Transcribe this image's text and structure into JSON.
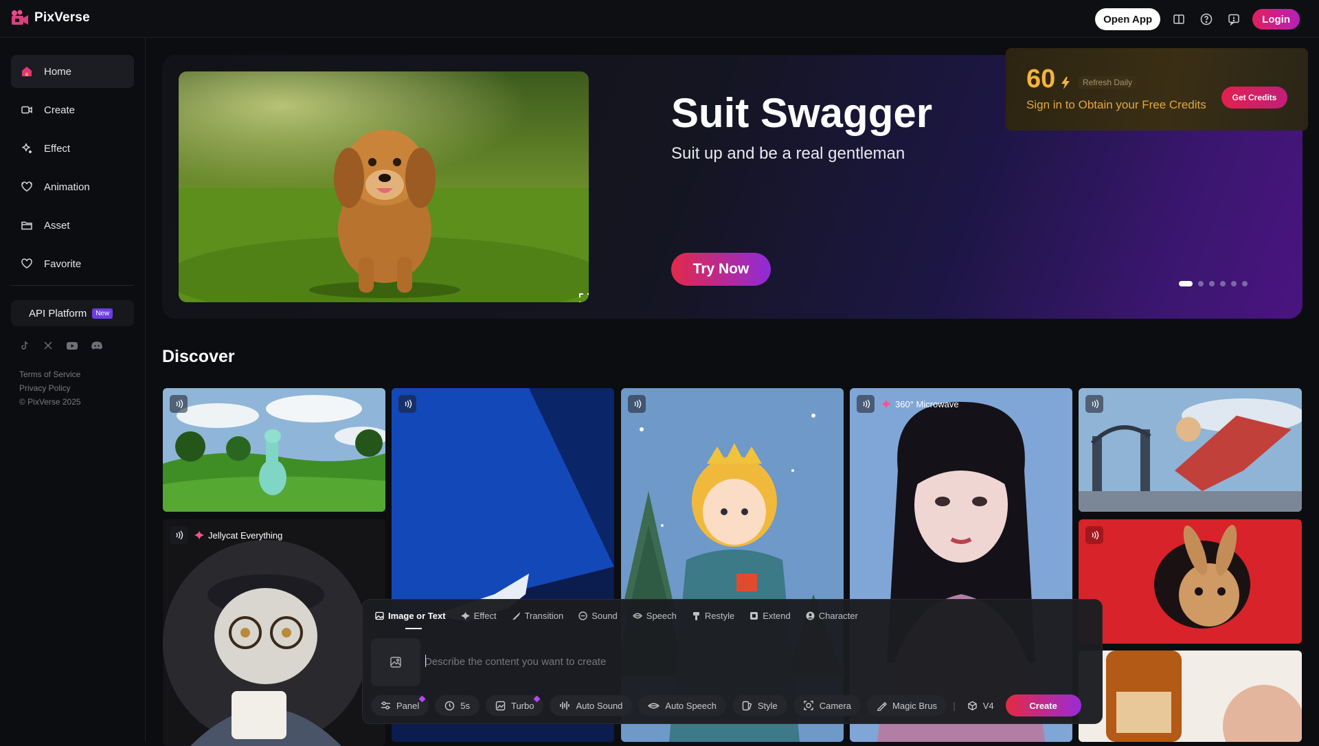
{
  "app": {
    "name": "PixVerse"
  },
  "header": {
    "open_app": "Open App",
    "login": "Login",
    "icons": [
      "book-icon",
      "help-icon",
      "feedback-icon"
    ]
  },
  "sidebar": {
    "items": [
      {
        "label": "Home",
        "icon": "home-icon",
        "active": true
      },
      {
        "label": "Create",
        "icon": "video-camera-icon"
      },
      {
        "label": "Effect",
        "icon": "sparkle-icon"
      },
      {
        "label": "Animation",
        "icon": "heart-hands-icon"
      },
      {
        "label": "Asset",
        "icon": "folder-icon"
      },
      {
        "label": "Favorite",
        "icon": "heart-icon"
      }
    ],
    "api": {
      "label": "API Platform",
      "badge": "New"
    },
    "socials": [
      "tiktok-icon",
      "x-icon",
      "youtube-icon",
      "discord-icon"
    ],
    "legal": {
      "terms": "Terms of Service",
      "privacy": "Privacy Policy",
      "copyright": "© PixVerse 2025"
    }
  },
  "hero": {
    "title": "Suit Swagger",
    "subtitle": "Suit up and be a real gentleman",
    "cta": "Try Now",
    "slides": 6,
    "active_slide": 1
  },
  "credits": {
    "amount": "60",
    "refresh": "Refresh Daily",
    "message": "Sign in to Obtain your Free Credits",
    "button": "Get Credits"
  },
  "discover": {
    "title": "Discover",
    "tags": {
      "microwave": "360° Microwave",
      "jellycat": "Jellycat Everything"
    }
  },
  "composer": {
    "tabs": [
      {
        "label": "Image or Text",
        "icon": "image-icon",
        "active": true
      },
      {
        "label": "Effect",
        "icon": "sparkle-icon"
      },
      {
        "label": "Transition",
        "icon": "transition-icon"
      },
      {
        "label": "Sound",
        "icon": "sound-icon"
      },
      {
        "label": "Speech",
        "icon": "speech-icon"
      },
      {
        "label": "Restyle",
        "icon": "brush-icon"
      },
      {
        "label": "Extend",
        "icon": "extend-icon"
      },
      {
        "label": "Character",
        "icon": "character-icon"
      }
    ],
    "placeholder": "Describe the content you want to create",
    "tools": [
      {
        "label": "Panel",
        "icon": "sliders-icon",
        "premium": true
      },
      {
        "label": "5s",
        "icon": "clock-icon"
      },
      {
        "label": "Turbo",
        "icon": "turbo-icon",
        "premium": true
      },
      {
        "label": "Auto Sound",
        "icon": "waveform-icon"
      },
      {
        "label": "Auto Speech",
        "icon": "lips-icon"
      },
      {
        "label": "Style",
        "icon": "style-icon"
      },
      {
        "label": "Camera",
        "icon": "camera-icon"
      },
      {
        "label": "Magic Brus",
        "icon": "magic-brush-icon"
      }
    ],
    "version": "V4",
    "create": "Create"
  },
  "colors": {
    "accent": "#e3204f",
    "accent_purple": "#9a2bd6",
    "credit_gold": "#f4b33b"
  }
}
